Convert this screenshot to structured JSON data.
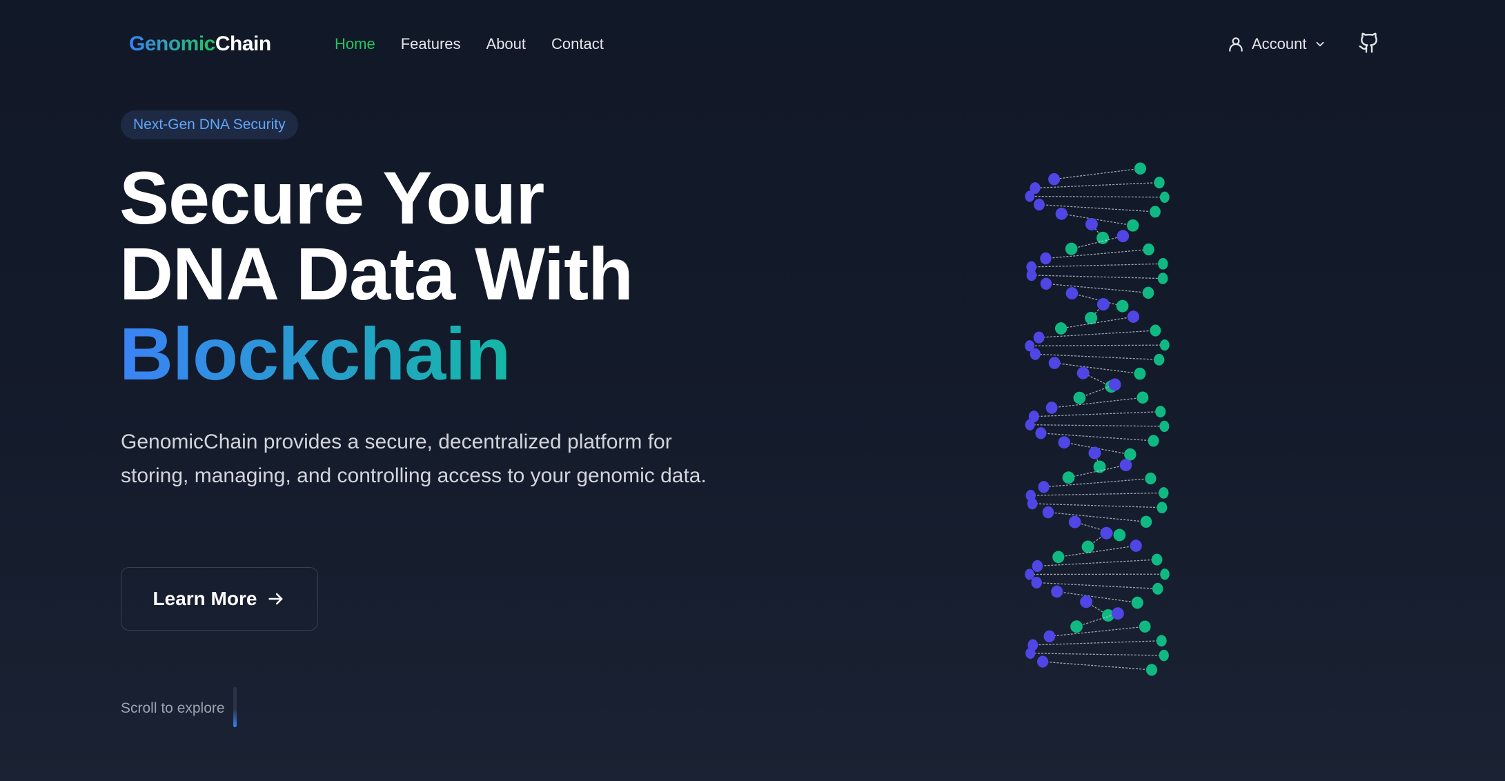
{
  "brand": {
    "name_part1": "Genomic",
    "name_part2": "Chain"
  },
  "nav": {
    "links": [
      {
        "label": "Home",
        "active": true
      },
      {
        "label": "Features",
        "active": false
      },
      {
        "label": "About",
        "active": false
      },
      {
        "label": "Contact",
        "active": false
      }
    ],
    "account_label": "Account",
    "account_icon": "user-icon",
    "github_icon": "github-icon"
  },
  "hero": {
    "badge": "Next-Gen DNA Security",
    "headline_line1": "Secure Your",
    "headline_line2": "DNA Data With",
    "headline_highlight": "Blockchain",
    "description": "GenomicChain provides a secure, decentralized platform for storing, managing, and controlling access to your genomic data.",
    "cta_label": "Learn More",
    "scroll_hint": "Scroll to explore"
  },
  "colors": {
    "background": "#111827",
    "accent_green": "#22c55e",
    "accent_blue": "#3b82f6",
    "helix_green": "#10b981",
    "helix_purple": "#4f46e5"
  }
}
